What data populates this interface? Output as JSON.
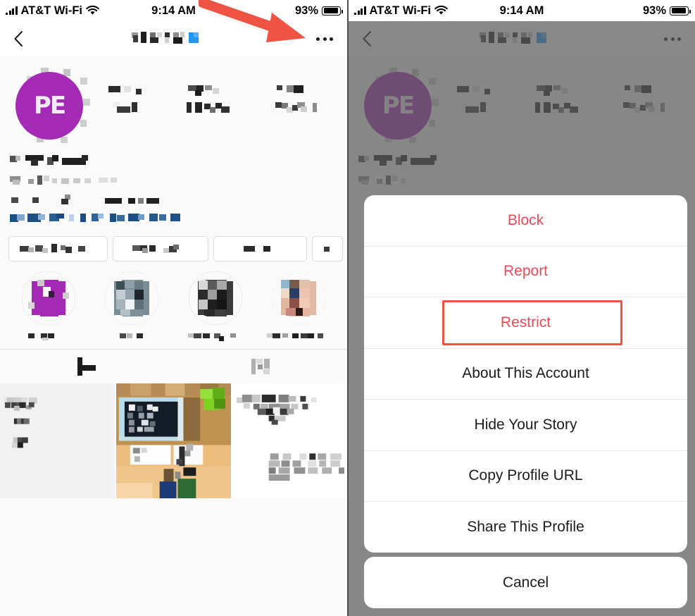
{
  "status_bar": {
    "carrier": "AT&T Wi-Fi",
    "time": "9:14 AM",
    "battery_percent": "93%",
    "signal_icon": "cellular-bars-icon",
    "wifi_icon": "wifi-icon",
    "battery_icon": "battery-icon"
  },
  "nav": {
    "back_icon": "chevron-left-icon",
    "title_redacted": true,
    "more_icon": "more-options-icon"
  },
  "profile": {
    "avatar_letters": "PE",
    "avatar_color": "#a42ab5",
    "stats_redacted": [
      "posts",
      "followers",
      "following"
    ],
    "bio_redacted": true,
    "action_buttons": [
      "button-1",
      "button-2",
      "button-3",
      "button-4"
    ],
    "highlights": [
      {
        "name": "highlight-1",
        "color": "#a42ab5"
      },
      {
        "name": "highlight-2",
        "color": "#6b7d86"
      },
      {
        "name": "highlight-3",
        "color": "#3b3b3b"
      },
      {
        "name": "highlight-4",
        "color": "#d6a58e"
      }
    ],
    "tabs": [
      {
        "name": "grid-tab",
        "icon": "grid-icon",
        "selected": true
      },
      {
        "name": "tagged-tab",
        "icon": "tagged-person-icon",
        "selected": false
      }
    ]
  },
  "annotation": {
    "arrow_color": "#ee5343",
    "arrow_target": "more-options-icon",
    "highlight_box_color": "#ee5343",
    "highlight_box_target": "Restrict"
  },
  "action_sheet": {
    "items": [
      {
        "label": "Block",
        "style": "destructive",
        "highlighted": false
      },
      {
        "label": "Report",
        "style": "destructive",
        "highlighted": false
      },
      {
        "label": "Restrict",
        "style": "destructive",
        "highlighted": true
      },
      {
        "label": "About This Account",
        "style": "default",
        "highlighted": false
      },
      {
        "label": "Hide Your Story",
        "style": "default",
        "highlighted": false
      },
      {
        "label": "Copy Profile URL",
        "style": "default",
        "highlighted": false
      },
      {
        "label": "Share This Profile",
        "style": "default",
        "highlighted": false
      }
    ],
    "cancel_label": "Cancel"
  }
}
